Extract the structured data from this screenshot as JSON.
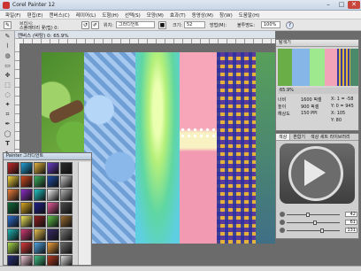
{
  "app": {
    "title": "Corel Painter 12"
  },
  "menu": [
    "파일(F)",
    "편집(E)",
    "캔버스(C)",
    "레이어(L)",
    "도형(H)",
    "선택(S)",
    "모양(M)",
    "효과(T)",
    "동영상(M)",
    "창(W)",
    "도움말(H)"
  ],
  "property_bar": {
    "brush_category_label": "브러시:",
    "brush_name": "스플래터리 꽃(팁) 0:",
    "effect_label": "위치:",
    "effect_value": "그라디언트",
    "size_label": "크기:",
    "size_value": "52",
    "method_label": "방법(M):",
    "opacity_label": "불투명도:",
    "opacity_value": "100%"
  },
  "document": {
    "title": "캔버스 (바탕) 0: 65.9%"
  },
  "navigator": {
    "title": "탐색기",
    "zoom": "65.9%",
    "info": [
      {
        "label": "너비",
        "value": "1600 픽셀",
        "extra": "X: 1 = -58"
      },
      {
        "label": "높이",
        "value": "900 픽셀",
        "extra": "Y: 0 = 945"
      },
      {
        "label": "해상도",
        "value": "150 PPI",
        "extra": "X: 105"
      },
      {
        "label": "",
        "value": "",
        "extra": "Y: 80"
      }
    ]
  },
  "color_panel": {
    "tabs": [
      "색상",
      "혼합기",
      "색상 세트 라이브러리"
    ],
    "sliders": [
      {
        "name": "hue",
        "value": "42"
      },
      {
        "name": "saturation",
        "value": "61"
      },
      {
        "name": "value",
        "value": "131"
      }
    ]
  },
  "pattern_panel": {
    "title": "Painter 그라디언트"
  },
  "colors": {
    "grads": [
      "#c6292a",
      "#22a0d6",
      "#e2b13b",
      "#6a3cc7",
      "#2b2b2b",
      "#f3d13b",
      "#d24b1f",
      "#3db05e",
      "#1f4ea8",
      "#c7c7c7",
      "#ef7f3a",
      "#8e2dc8",
      "#22c4c4",
      "#f2f2f2",
      "#b3b3b3",
      "#0f6a3a",
      "#d7a51f",
      "#1f1f88",
      "#e85a9b",
      "#4a4a4a",
      "#2d6fd1",
      "#f3ea5d",
      "#8f1f1f",
      "#5ec24a",
      "#9a6b2f",
      "#1fb5b5",
      "#d13a76",
      "#e8c14f",
      "#3a2a6a",
      "#777777",
      "#a7d84a",
      "#d93a3a",
      "#4fa3e3",
      "#f0a03a",
      "#6b6b6b",
      "#272f7a",
      "#f5c9d9",
      "#3fbf84",
      "#b23a1f",
      "#dddddd"
    ]
  }
}
